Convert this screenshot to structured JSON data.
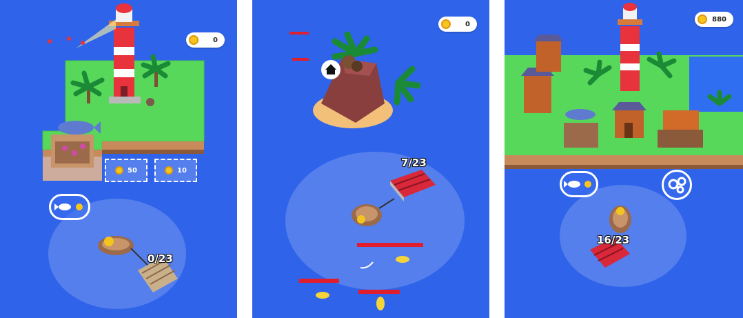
{
  "screens": [
    {
      "coins": "0",
      "load_counter": "0/23",
      "price_pads": [
        "50",
        "10"
      ],
      "exchange_icon": "fish-to-coin-icon"
    },
    {
      "coins": "0",
      "load_counter": "7/23",
      "home_icon": "home-icon"
    },
    {
      "coins": "880",
      "load_counter": "16/23",
      "exchange_icon": "fish-to-coin-icon",
      "settings_icon": "gears-icon"
    }
  ],
  "colors": {
    "ocean": "#2f63ea",
    "grass": "#58d85a",
    "coin": "#f7c51e",
    "lighthouse_red": "#e8323c",
    "raft_red": "#d8283a"
  }
}
